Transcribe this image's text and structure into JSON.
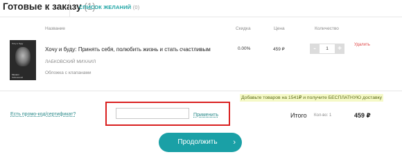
{
  "tabs": {
    "ready": {
      "label": "Готовые к заказу",
      "count": "(1)"
    },
    "wishlist": {
      "label": "СПИСОК ЖЕЛАНИЙ",
      "count": "(0)"
    }
  },
  "table": {
    "headers": {
      "name": "Название",
      "discount": "Скидка",
      "price": "Цена",
      "quantity": "Количество"
    }
  },
  "product": {
    "cover_title": "Хочу и буду",
    "cover_author_line1": "Михаил",
    "cover_author_line2": "Лабковский",
    "title": "Хочу и буду: Принять себя, полюбить жизнь и стать счастливым",
    "author": "ЛАБКОВСКИЙ МИХАИЛ",
    "cover_type": "Обложка с клапанами",
    "discount": "0.00%",
    "price": "459 ₽",
    "quantity": "1",
    "qty_minus": "-",
    "qty_plus": "+",
    "remove_label": "Удалить"
  },
  "promo": {
    "banner": "Добавьте товаров на 1541₽ и получите БЕСПЛАТНУЮ доставку",
    "link_label": "Есть промо-код/сертификат?",
    "input_value": "",
    "input_placeholder": "",
    "apply_label": "Применить"
  },
  "summary": {
    "total_label": "Итого",
    "count_label": "Кол-во: 1",
    "total_sum": "459 ₽"
  },
  "continue_label": "Продолжить",
  "continue_icon": "chevron-right-icon",
  "colors": {
    "accent": "#1aa0a6",
    "remove": "#e04848",
    "highlight_box": "#d91e1e",
    "promo_banner_bg": "#f5f9c7"
  }
}
